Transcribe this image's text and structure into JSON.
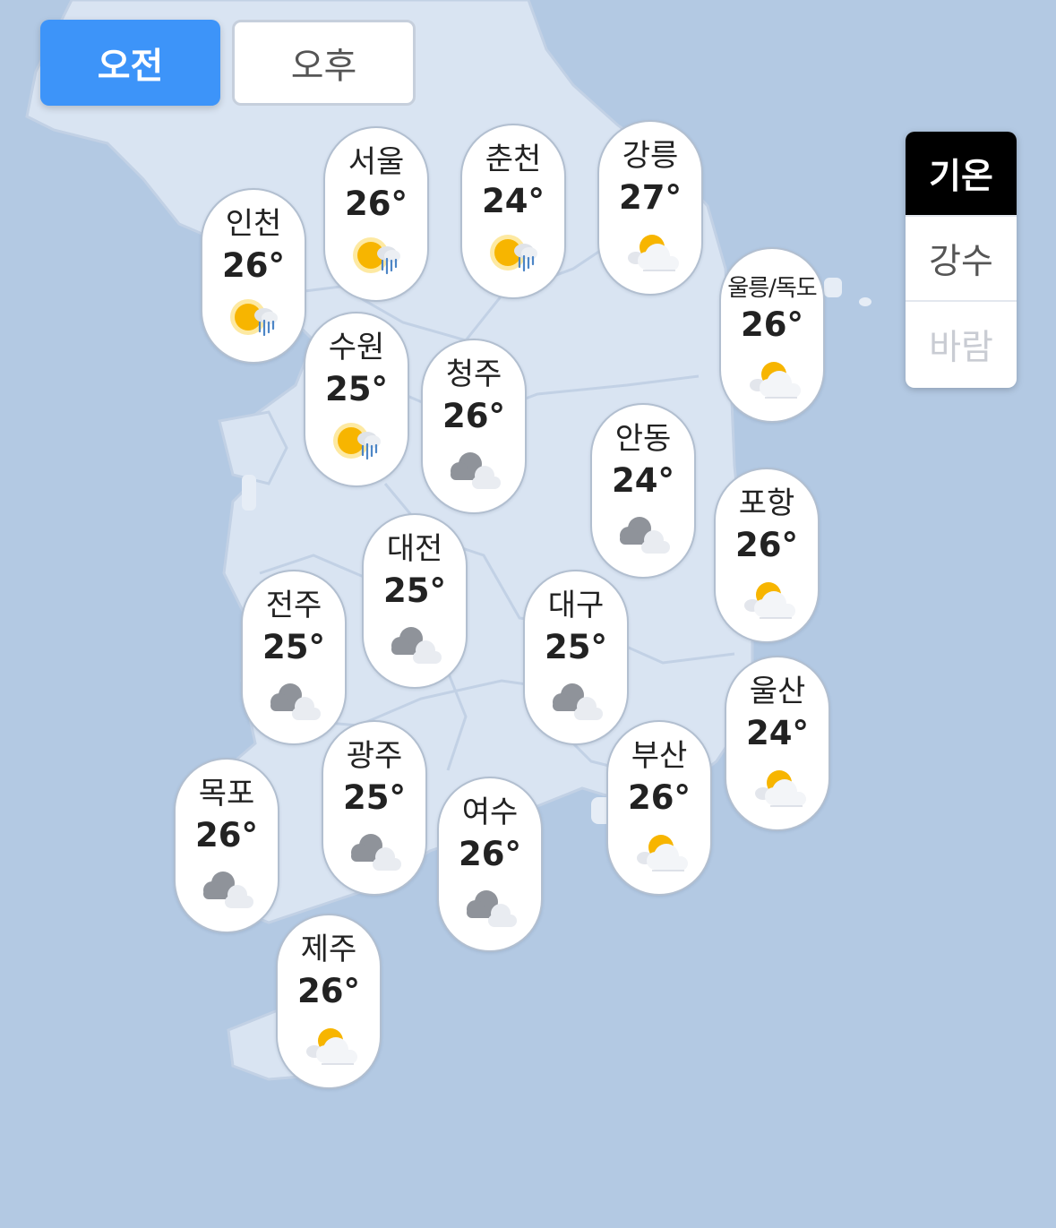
{
  "toggle": {
    "am": "오전",
    "pm": "오후"
  },
  "layers": {
    "temperature": "기온",
    "precipitation": "강수",
    "wind": "바람"
  },
  "cities": [
    {
      "name": "서울",
      "temp": "26°",
      "icon": "sun-rain-icon"
    },
    {
      "name": "춘천",
      "temp": "24°",
      "icon": "sun-rain-icon"
    },
    {
      "name": "강릉",
      "temp": "27°",
      "icon": "partly-cloudy-icon"
    },
    {
      "name": "인천",
      "temp": "26°",
      "icon": "sun-rain-icon"
    },
    {
      "name": "울릉/독도",
      "temp": "26°",
      "icon": "partly-cloudy-icon"
    },
    {
      "name": "수원",
      "temp": "25°",
      "icon": "sun-rain-icon"
    },
    {
      "name": "청주",
      "temp": "26°",
      "icon": "cloudy-icon"
    },
    {
      "name": "안동",
      "temp": "24°",
      "icon": "cloudy-icon"
    },
    {
      "name": "포항",
      "temp": "26°",
      "icon": "partly-cloudy-icon"
    },
    {
      "name": "대전",
      "temp": "25°",
      "icon": "cloudy-icon"
    },
    {
      "name": "전주",
      "temp": "25°",
      "icon": "cloudy-icon"
    },
    {
      "name": "대구",
      "temp": "25°",
      "icon": "cloudy-icon"
    },
    {
      "name": "울산",
      "temp": "24°",
      "icon": "partly-cloudy-icon"
    },
    {
      "name": "광주",
      "temp": "25°",
      "icon": "cloudy-icon"
    },
    {
      "name": "부산",
      "temp": "26°",
      "icon": "partly-cloudy-icon"
    },
    {
      "name": "목포",
      "temp": "26°",
      "icon": "cloudy-icon"
    },
    {
      "name": "여수",
      "temp": "26°",
      "icon": "cloudy-icon"
    },
    {
      "name": "제주",
      "temp": "26°",
      "icon": "partly-cloudy-icon"
    }
  ]
}
